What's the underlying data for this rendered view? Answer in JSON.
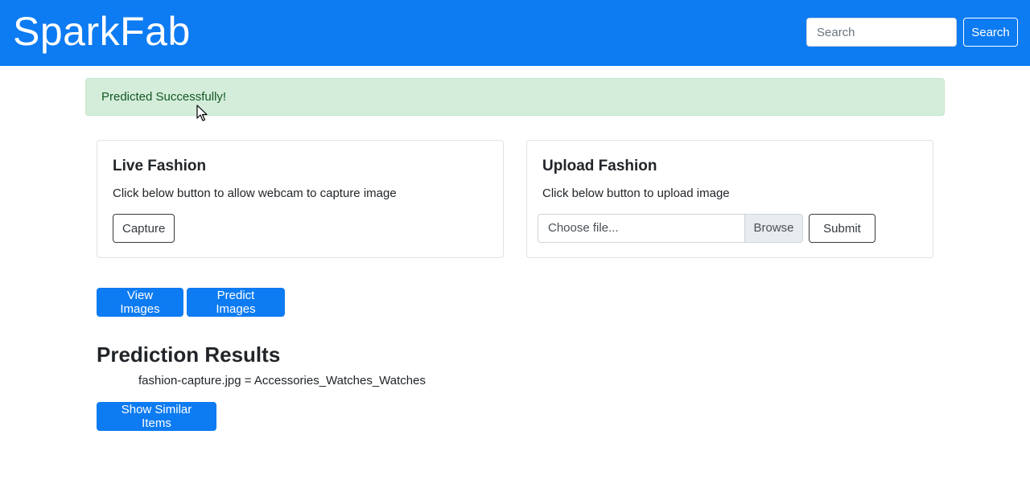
{
  "navbar": {
    "brand": "SparkFab",
    "search_placeholder": "Search",
    "search_button": "Search",
    "background_color": "#0d7bf2"
  },
  "alert": {
    "message": "Predicted Successfully!",
    "type": "success"
  },
  "live_card": {
    "title": "Live Fashion",
    "description": "Click below button to allow webcam to capture image",
    "capture_button": "Capture"
  },
  "upload_card": {
    "title": "Upload Fashion",
    "description": "Click below button to upload image",
    "file_placeholder": "Choose file...",
    "browse_label": "Browse",
    "submit_button": "Submit"
  },
  "actions": {
    "view_images": "View Images",
    "predict_images": "Predict Images"
  },
  "results": {
    "title": "Prediction Results",
    "items": [
      "fashion-capture.jpg = Accessories_Watches_Watches"
    ],
    "similar_button": "Show Similar Items"
  },
  "icons": {
    "cursor": "mouse-pointer-icon"
  }
}
